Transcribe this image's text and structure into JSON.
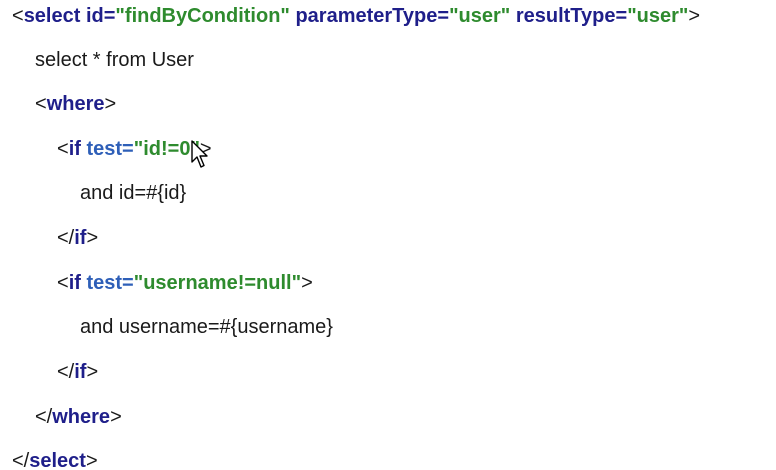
{
  "colors": {
    "tag": "#1f1f8a",
    "attr_test": "#2e5fb8",
    "value": "#2e8b2e",
    "text": "#1a1a1a"
  },
  "code": {
    "line1": {
      "open": "<",
      "tag": "select",
      "attr1": " id=",
      "val1": "\"findByCondition\"",
      "attr2": " parameterType=",
      "val2": "\"user\"",
      "attr3": " resultType=",
      "val3": "\"user\"",
      "close": ">"
    },
    "line2": {
      "text": "select * from User"
    },
    "line3": {
      "open": "<",
      "tag": "where",
      "close": ">"
    },
    "line4": {
      "open": "<",
      "tag": "if",
      "attr": " test=",
      "val": "\"id!=0\"",
      "close": ">"
    },
    "line5": {
      "text": "and id=#{id}"
    },
    "line6": {
      "open": "</",
      "tag": "if",
      "close": ">"
    },
    "line7": {
      "open": "<",
      "tag": "if",
      "attr": " test=",
      "val": "\"username!=null\"",
      "close": ">"
    },
    "line8": {
      "text": "and username=#{username}"
    },
    "line9": {
      "open": "</",
      "tag": "if",
      "close": ">"
    },
    "line10": {
      "open": "</",
      "tag": "where",
      "close": ">"
    },
    "line11": {
      "open": "</",
      "tag": "select",
      "close": ">"
    }
  },
  "cursor_icon": "mouse-pointer-icon"
}
